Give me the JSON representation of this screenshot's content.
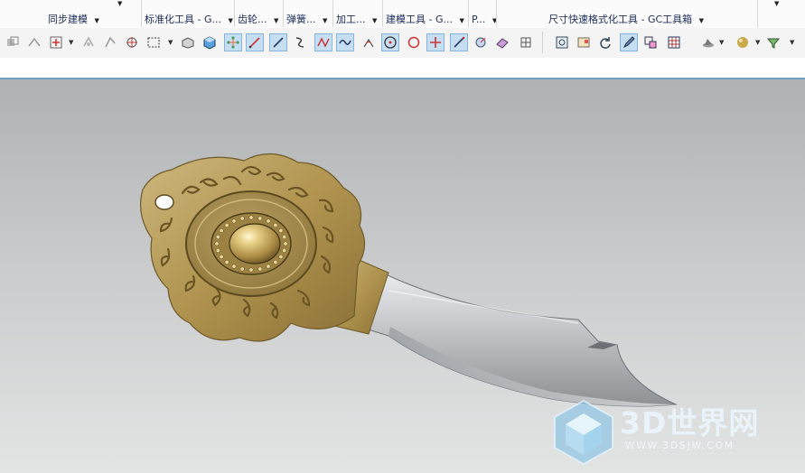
{
  "ribbon": {
    "groups": [
      {
        "label": "同步建模",
        "has_dropdown": false
      },
      {
        "label": "标准化工具 - G...",
        "has_dropdown": true
      },
      {
        "label": "齿轮...",
        "has_dropdown": true
      },
      {
        "label": "弹簧...",
        "has_dropdown": true
      },
      {
        "label": "加工...",
        "has_dropdown": true
      },
      {
        "label": "建模工具 - G...",
        "has_dropdown": true
      },
      {
        "label": "P...",
        "has_dropdown": true
      },
      {
        "label": "尺寸快速格式化工具 - GC工具箱",
        "has_dropdown": true
      }
    ]
  },
  "toolbar": {
    "icons": [
      "offset-region-icon",
      "replace-face-icon",
      "add-point-icon",
      "move-face-icon",
      "pull-face-icon",
      "snap-point-icon",
      "select-box-icon",
      "shaded-box-icon",
      "blue-cube-icon",
      "fit-points-icon",
      "line-icon",
      "diagonal-line-icon",
      "curve-s-icon",
      "studio-spline-icon",
      "sine-curve-icon",
      "arc-angle-icon",
      "circle-center-icon",
      "circle-icon",
      "cross-point-icon",
      "slash-line-icon",
      "view-orient-icon",
      "grid-plane-icon",
      "mesh-icon",
      "zoom-view-icon",
      "render-view-icon",
      "refresh-icon",
      "edit-object-icon",
      "layer-settings-icon",
      "table-grid-icon",
      "material-hat-icon",
      "sphere-material-icon",
      "filter-triangle-icon"
    ],
    "active": [
      "fit-points-icon",
      "line-icon",
      "diagonal-line-icon",
      "studio-spline-icon",
      "sine-curve-icon",
      "circle-center-icon",
      "cross-point-icon",
      "slash-line-icon",
      "edit-object-icon"
    ]
  },
  "watermark": {
    "title": "3D世界网",
    "url": "WWW.3DSJW.COM"
  },
  "colors": {
    "viewport_top": "#aeb2b3",
    "viewport_bottom": "#e3e4e4",
    "viewport_border": "#6f9ec7",
    "handle_gold": "#b59b5c",
    "blade_steel": "#c0c2c5",
    "ribbon_text": "#1c2c5a"
  }
}
